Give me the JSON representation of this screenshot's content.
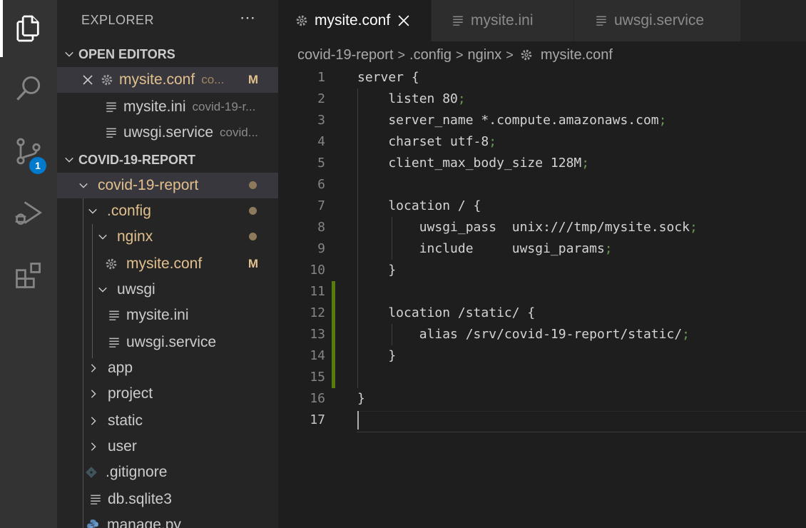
{
  "activity_bar": {
    "items": [
      {
        "name": "explorer",
        "icon": "files-icon"
      },
      {
        "name": "search",
        "icon": "search-icon"
      },
      {
        "name": "source-control",
        "icon": "source-control-icon",
        "badge": "1"
      },
      {
        "name": "run-debug",
        "icon": "run-debug-icon"
      },
      {
        "name": "extensions",
        "icon": "extensions-icon"
      }
    ]
  },
  "sidebar": {
    "title": "EXPLORER",
    "more": "⋯",
    "open_editors": {
      "label": "OPEN EDITORS",
      "items": [
        {
          "name": "mysite.conf",
          "desc": "co...",
          "status": "M"
        },
        {
          "name": "mysite.ini",
          "desc": "covid-19-r..."
        },
        {
          "name": "uwsgi.service",
          "desc": "covid..."
        }
      ]
    },
    "workspace": {
      "label": "COVID-19-REPORT",
      "tree": [
        {
          "label": "covid-19-report"
        },
        {
          "label": ".config"
        },
        {
          "label": "nginx"
        },
        {
          "label": "mysite.conf",
          "status": "M"
        },
        {
          "label": "uwsgi"
        },
        {
          "label": "mysite.ini"
        },
        {
          "label": "uwsgi.service"
        },
        {
          "label": "app"
        },
        {
          "label": "project"
        },
        {
          "label": "static"
        },
        {
          "label": "user"
        },
        {
          "label": ".gitignore"
        },
        {
          "label": "db.sqlite3"
        },
        {
          "label": "manage.py"
        }
      ]
    }
  },
  "tabs": [
    {
      "label": "mysite.conf",
      "active": true
    },
    {
      "label": "mysite.ini"
    },
    {
      "label": "uwsgi.service"
    }
  ],
  "breadcrumb": [
    "covid-19-report",
    ".config",
    "nginx",
    "mysite.conf"
  ],
  "editor": {
    "lines": [
      {
        "n": "1",
        "text": "server {"
      },
      {
        "n": "2",
        "text": "    listen 80",
        "semi": ";"
      },
      {
        "n": "3",
        "text": "    server_name *.compute.amazonaws.com",
        "semi": ";"
      },
      {
        "n": "4",
        "text": "    charset utf-8",
        "semi": ";"
      },
      {
        "n": "5",
        "text": "    client_max_body_size 128M",
        "semi": ";"
      },
      {
        "n": "6",
        "text": ""
      },
      {
        "n": "7",
        "text": "    location / {"
      },
      {
        "n": "8",
        "text": "        uwsgi_pass  unix:///tmp/mysite.sock",
        "semi": ";"
      },
      {
        "n": "9",
        "text": "        include     uwsgi_params",
        "semi": ";"
      },
      {
        "n": "10",
        "text": "    }"
      },
      {
        "n": "11",
        "text": ""
      },
      {
        "n": "12",
        "text": "    location /static/ {"
      },
      {
        "n": "13",
        "text": "        alias /srv/covid-19-report/static/",
        "semi": ";"
      },
      {
        "n": "14",
        "text": "    }"
      },
      {
        "n": "15",
        "text": ""
      },
      {
        "n": "16",
        "text": "}"
      },
      {
        "n": "17",
        "text": ""
      }
    ]
  },
  "colors": {
    "modified": "#e2c08d",
    "accent": "#007acc",
    "gutter_added": "#587c0c"
  }
}
